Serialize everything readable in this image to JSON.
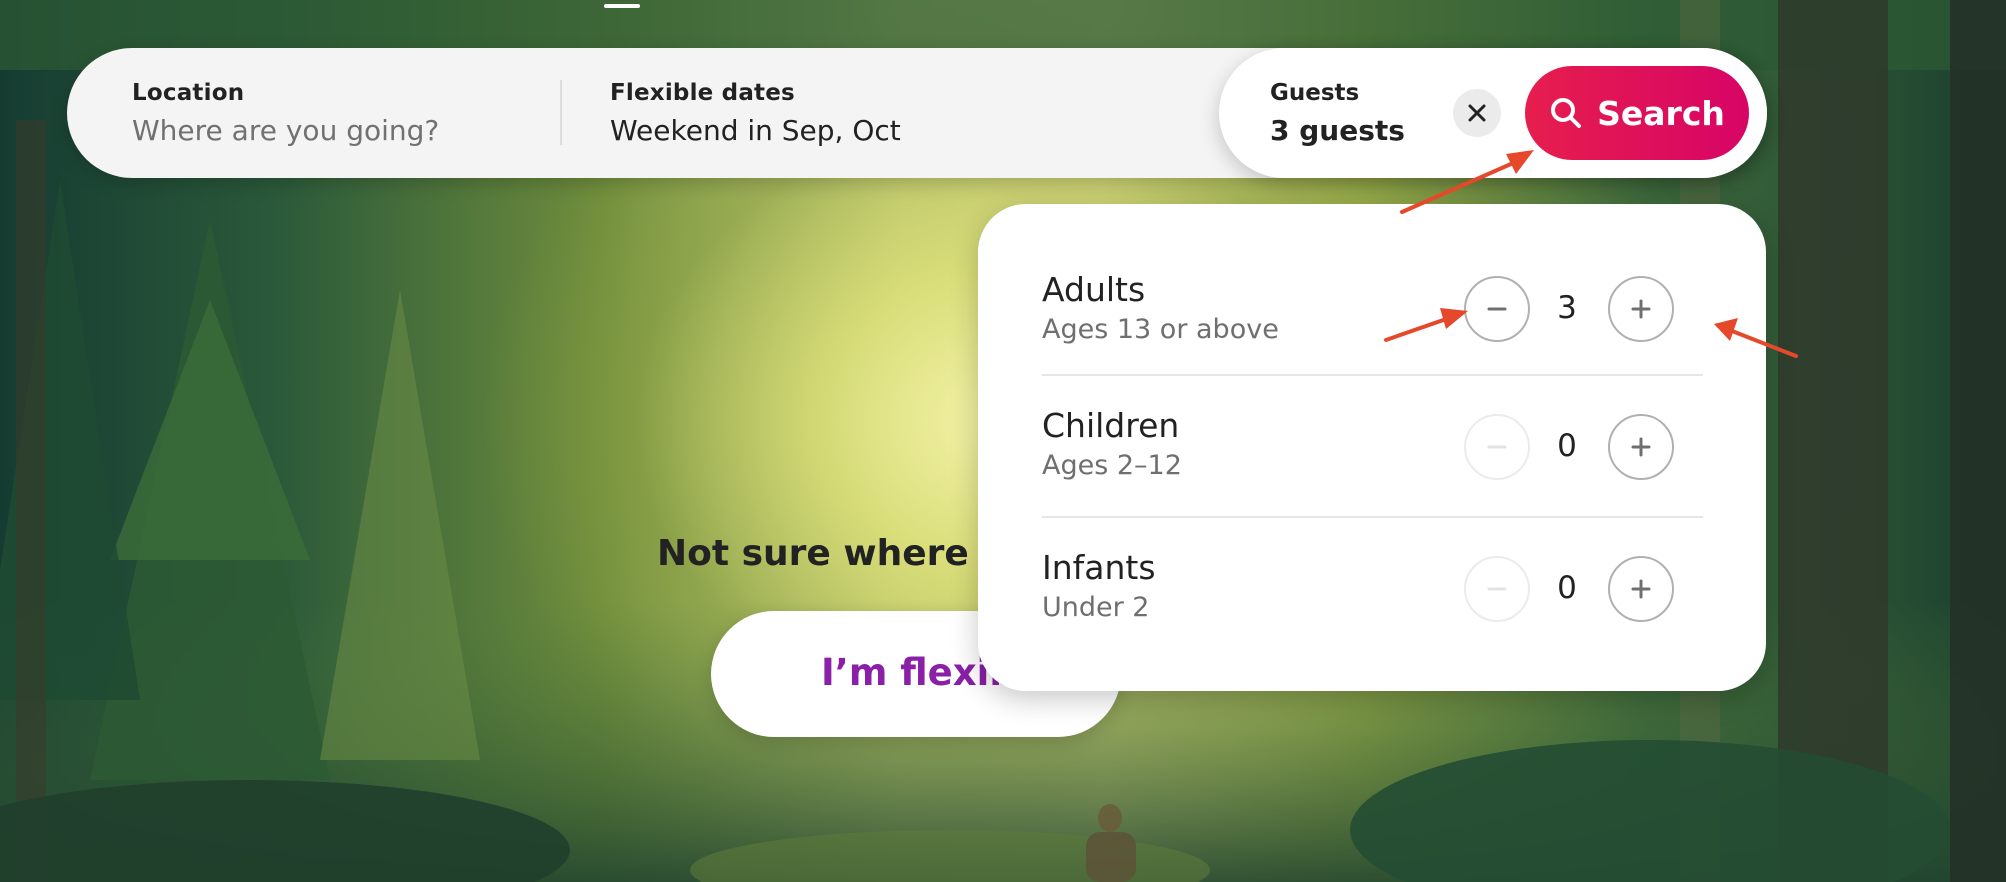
{
  "search": {
    "location_label": "Location",
    "location_placeholder": "Where are you going?",
    "dates_label": "Flexible dates",
    "dates_value": "Weekend in Sep, Oct",
    "guests_label": "Guests",
    "guests_value": "3 guests",
    "search_label": "Search"
  },
  "hero": {
    "headline": "Not sure where to g",
    "flexible_label": "I’m flexible"
  },
  "guest_panel": {
    "rows": [
      {
        "title": "Adults",
        "subtitle": "Ages 13 or above",
        "count": "3",
        "minus_enabled": true
      },
      {
        "title": "Children",
        "subtitle": "Ages 2–12",
        "count": "0",
        "minus_enabled": false
      },
      {
        "title": "Infants",
        "subtitle": "Under 2",
        "count": "0",
        "minus_enabled": false
      }
    ]
  },
  "icons": {
    "clear": "close-icon",
    "search": "search-icon",
    "minus": "minus-icon",
    "plus": "plus-icon",
    "annotation": "arrow-icon"
  },
  "colors": {
    "search_button": "#e61e4d",
    "flexible_text": "#8a1fa8",
    "annotation_arrow": "#e5482a"
  }
}
